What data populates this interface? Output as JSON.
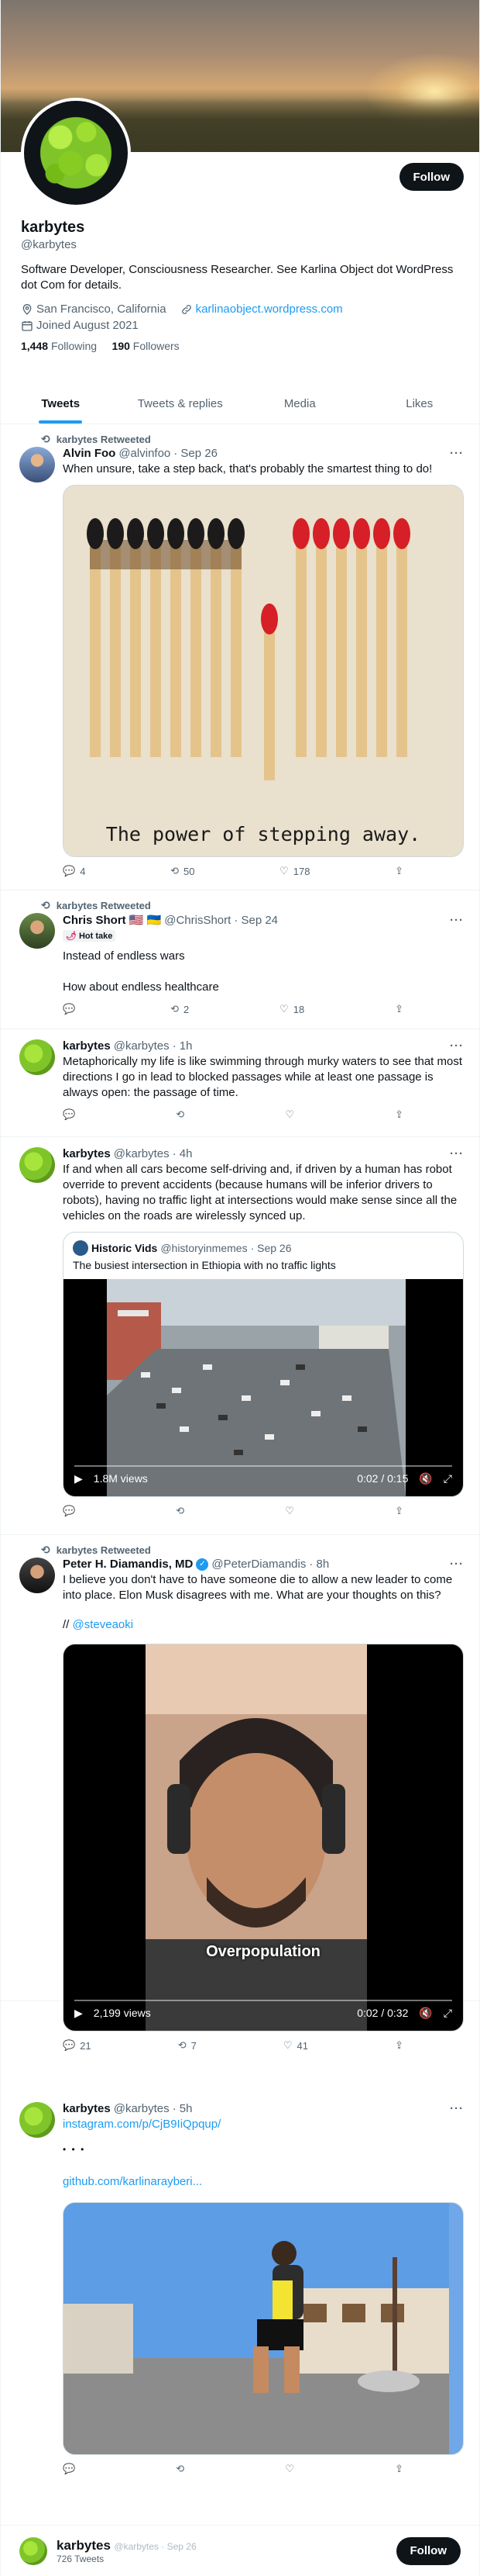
{
  "profile": {
    "name": "karbytes",
    "handle": "@karbytes",
    "bio": "Software Developer, Consciousness Researcher. See Karlina Object dot WordPress dot Com for details.",
    "location": "San Francisco, California",
    "website": "karlinaobject.wordpress.com",
    "joined": "Joined August 2021",
    "following_count": "1,448",
    "following_label": "Following",
    "followers_count": "190",
    "followers_label": "Followers",
    "follow_label": "Follow"
  },
  "tabs": [
    {
      "label": "Tweets"
    },
    {
      "label": "Tweets & replies"
    },
    {
      "label": "Media"
    },
    {
      "label": "Likes"
    }
  ],
  "tweets": [
    {
      "retweet_label": "karbytes Retweeted",
      "name": "Alvin Foo",
      "handle": "@alvinfoo",
      "date": "· Sep 26",
      "text": "When unsure, take a step back, that's probably the smartest thing to do!",
      "image_caption": "The power of stepping away.",
      "replies": "4",
      "retweets": "50",
      "likes": "178"
    },
    {
      "retweet_label": "karbytes Retweeted",
      "name": "Chris Short",
      "flags": "🇺🇸 🇺🇦",
      "handle": "@ChrisShort",
      "date": "· Sep 24",
      "badge": "Hot take",
      "text1": "Instead of endless wars",
      "text2": "How about endless healthcare",
      "replies": "",
      "retweets": "2",
      "likes": "18"
    },
    {
      "name": "karbytes",
      "handle": "@karbytes",
      "date": "· 1h",
      "text": "Metaphorically my life is like swimming through murky waters to see that most directions I go in lead to blocked passages while at least one passage is always open: the passage of time."
    },
    {
      "name": "karbytes",
      "handle": "@karbytes",
      "date": "· 4h",
      "text": "If and when all cars become self-driving and, if driven by a human has robot override to prevent accidents (because humans will be inferior drivers to robots), having no traffic light at intersections would make sense since all the vehicles on the roads are wirelessly synced up.",
      "quote_name": "Historic Vids",
      "quote_handle": "@historyinmemes",
      "quote_date": "· Sep 26",
      "quote_text": "The busiest intersection in Ethiopia with no traffic lights",
      "views": "1.8M views",
      "time": "0:02 / 0:15"
    },
    {
      "retweet_label": "karbytes Retweeted",
      "name": "Peter H. Diamandis, MD",
      "handle": "@PeterDiamandis",
      "date": "· 8h",
      "text": "I believe you don't have to have someone die to allow a new leader to come into place. Elon Musk disagrees with me. What are your thoughts on this?",
      "mention_prefix": "// ",
      "mention": "@steveaoki",
      "video_caption": "Overpopulation",
      "views": "2,199 views",
      "time": "0:02 / 0:32",
      "replies": "21",
      "retweets": "7",
      "likes": "41"
    },
    {
      "name": "karbytes",
      "handle": "@karbytes",
      "date": "· 5h",
      "link1": "instagram.com/p/CjB9IiQpqup/",
      "ellipsis": "• • •",
      "link2": "github.com/karlinarayberi..."
    }
  ],
  "bottom_bar": {
    "name": "karbytes",
    "handle": "@karbytes · Sep 26",
    "tweets": "726 Tweets",
    "follow_label": "Follow"
  }
}
